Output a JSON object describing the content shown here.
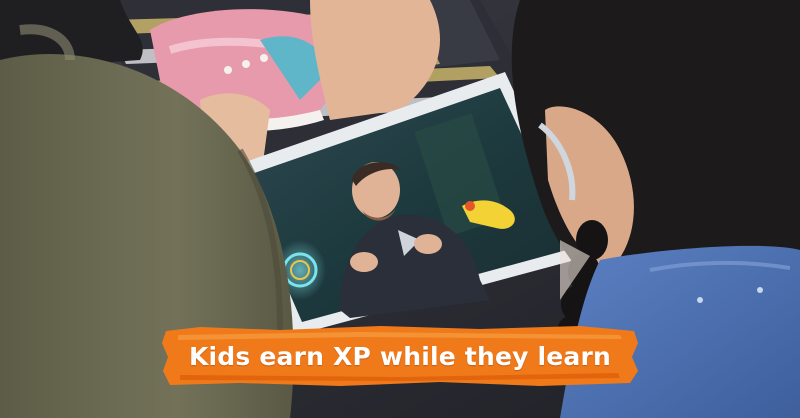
{
  "caption": "Kids earn XP while they learn",
  "colors": {
    "banner_orange": "#f07a1a",
    "banner_orange_dark": "#e0620c",
    "jacket_olive": "#6b6a52",
    "denim_blue": "#4f74b8",
    "hair": "#1c1a1a"
  },
  "icons": {
    "banner": "brush-stroke-banner"
  }
}
